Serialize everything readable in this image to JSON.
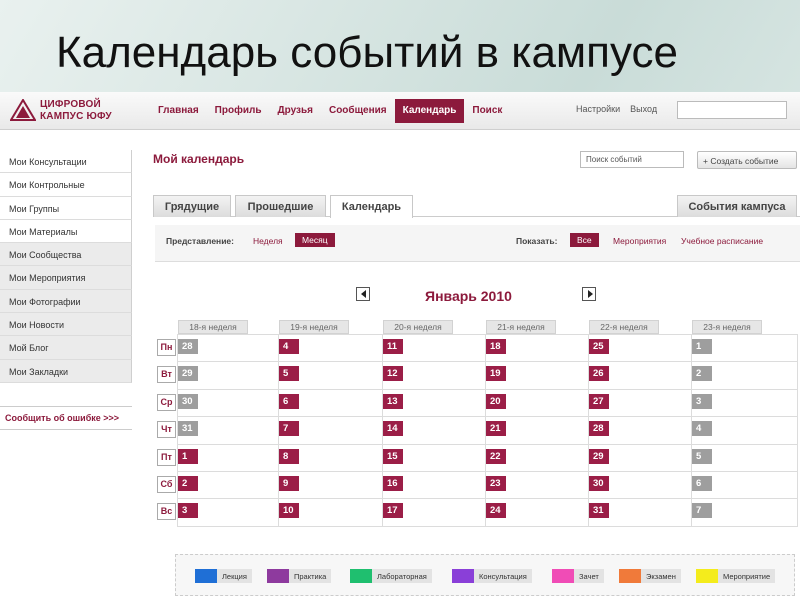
{
  "slide_title": "Календарь событий в кампусе",
  "logo": {
    "line1": "ЦИФРОВОЙ",
    "line2": "КАМПУС ЮФУ"
  },
  "nav": [
    {
      "label": "Главная"
    },
    {
      "label": "Профиль"
    },
    {
      "label": "Друзья"
    },
    {
      "label": "Сообщения"
    },
    {
      "label": "Календарь"
    },
    {
      "label": "Поиск"
    }
  ],
  "top_links": {
    "settings": "Настройки",
    "logout": "Выход"
  },
  "sidebar": [
    {
      "label": "Мои Консультации"
    },
    {
      "label": "Мои Контрольные"
    },
    {
      "label": "Мои Группы"
    },
    {
      "label": "Мои Материалы"
    },
    {
      "label": "Мои Сообщества"
    },
    {
      "label": "Мои Мероприятия"
    },
    {
      "label": "Мои Фотографии"
    },
    {
      "label": "Мои Новости"
    },
    {
      "label": "Мой Блог"
    },
    {
      "label": "Мои Закладки"
    }
  ],
  "report_link": "Сообщить об ошибке >>>",
  "page_title": "Мой календарь",
  "event_search_placeholder": "Поиск событий",
  "create_event": "+ Создать событие",
  "tabs": [
    {
      "label": "Грядущие"
    },
    {
      "label": "Прошедшие"
    },
    {
      "label": "Календарь"
    }
  ],
  "campus_events_tab": "События кампуса",
  "view": {
    "label": "Представление:",
    "week": "Неделя",
    "month": "Месяц"
  },
  "show": {
    "label": "Показать:",
    "all": "Все",
    "events": "Мероприятия",
    "schedule": "Учебное расписание"
  },
  "month_title": "Январь 2010",
  "weeks": [
    "18-я неделя",
    "19-я неделя",
    "20-я неделя",
    "21-я неделя",
    "22-я неделя",
    "23-я неделя"
  ],
  "days": [
    "Пн",
    "Вт",
    "Ср",
    "Чт",
    "Пт",
    "Сб",
    "Вс"
  ],
  "dates": [
    [
      {
        "d": "28",
        "m": "oth"
      },
      {
        "d": "29",
        "m": "oth"
      },
      {
        "d": "30",
        "m": "oth"
      },
      {
        "d": "31",
        "m": "oth"
      },
      {
        "d": "1",
        "m": "cur"
      },
      {
        "d": "2",
        "m": "cur"
      },
      {
        "d": "3",
        "m": "cur"
      }
    ],
    [
      {
        "d": "4",
        "m": "cur"
      },
      {
        "d": "5",
        "m": "cur"
      },
      {
        "d": "6",
        "m": "cur"
      },
      {
        "d": "7",
        "m": "cur"
      },
      {
        "d": "8",
        "m": "cur"
      },
      {
        "d": "9",
        "m": "cur"
      },
      {
        "d": "10",
        "m": "cur"
      }
    ],
    [
      {
        "d": "11",
        "m": "cur"
      },
      {
        "d": "12",
        "m": "cur"
      },
      {
        "d": "13",
        "m": "cur"
      },
      {
        "d": "14",
        "m": "cur"
      },
      {
        "d": "15",
        "m": "cur"
      },
      {
        "d": "16",
        "m": "cur"
      },
      {
        "d": "17",
        "m": "cur"
      }
    ],
    [
      {
        "d": "18",
        "m": "cur"
      },
      {
        "d": "19",
        "m": "cur"
      },
      {
        "d": "20",
        "m": "cur"
      },
      {
        "d": "21",
        "m": "cur"
      },
      {
        "d": "22",
        "m": "cur"
      },
      {
        "d": "23",
        "m": "cur"
      },
      {
        "d": "24",
        "m": "cur"
      }
    ],
    [
      {
        "d": "25",
        "m": "cur"
      },
      {
        "d": "26",
        "m": "cur"
      },
      {
        "d": "27",
        "m": "cur"
      },
      {
        "d": "28",
        "m": "cur"
      },
      {
        "d": "29",
        "m": "cur"
      },
      {
        "d": "30",
        "m": "cur"
      },
      {
        "d": "31",
        "m": "cur"
      }
    ],
    [
      {
        "d": "1",
        "m": "oth"
      },
      {
        "d": "2",
        "m": "oth"
      },
      {
        "d": "3",
        "m": "oth"
      },
      {
        "d": "4",
        "m": "oth"
      },
      {
        "d": "5",
        "m": "oth"
      },
      {
        "d": "6",
        "m": "oth"
      },
      {
        "d": "7",
        "m": "oth"
      }
    ]
  ],
  "legend": [
    {
      "label": "Лекция",
      "color": "#1f6fd6"
    },
    {
      "label": "Практика",
      "color": "#8e3a9e"
    },
    {
      "label": "Лабораторная",
      "color": "#1fbf6f"
    },
    {
      "label": "Консультация",
      "color": "#8a3fd8"
    },
    {
      "label": "Зачет",
      "color": "#f04cb6"
    },
    {
      "label": "Экзамен",
      "color": "#f07a3a"
    },
    {
      "label": "Мероприятие",
      "color": "#f4ec1c"
    }
  ],
  "colors": {
    "accent": "#8c1a3c",
    "date_current": "#9b1e47",
    "date_other": "#9e9e9e"
  }
}
